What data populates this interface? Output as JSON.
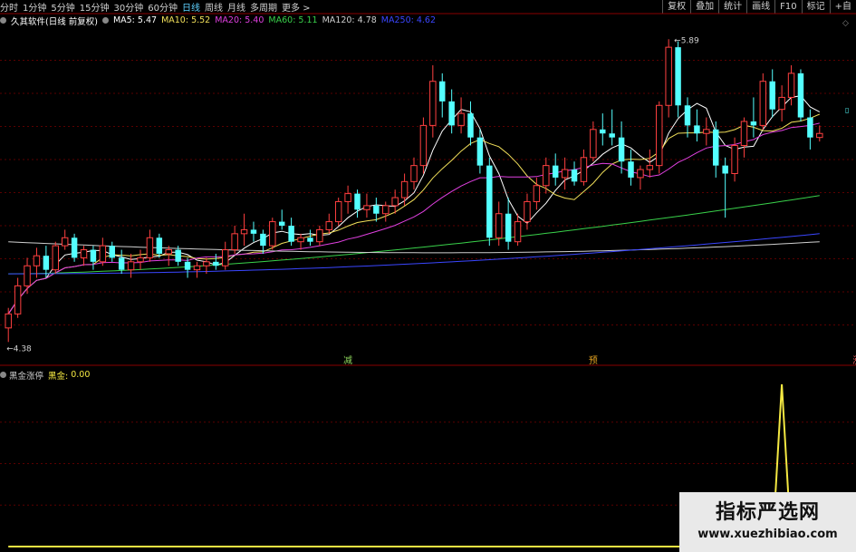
{
  "toolbar": {
    "periods": [
      "分时",
      "1分钟",
      "5分钟",
      "15分钟",
      "30分钟",
      "60分钟",
      "日线",
      "周线",
      "月线",
      "多周期",
      "更多 >"
    ],
    "active_period": "日线",
    "buttons": [
      "复权",
      "叠加",
      "统计",
      "画线",
      "F10",
      "标记",
      "+自"
    ]
  },
  "legend": {
    "title": "久其软件(日线 前复权)",
    "items": [
      {
        "label": "MA5: 5.47",
        "color": "#ffffff"
      },
      {
        "label": "MA10: 5.52",
        "color": "#f2e05a"
      },
      {
        "label": "MA20: 5.40",
        "color": "#e040e0"
      },
      {
        "label": "MA60: 5.11",
        "color": "#39d14a"
      },
      {
        "label": "MA120: 4.78",
        "color": "#cfcfcf"
      },
      {
        "label": "MA250: 4.62",
        "color": "#3a46ff"
      }
    ]
  },
  "price_labels": {
    "high": "5.89",
    "low": "4.38"
  },
  "signals": [
    {
      "label": "减",
      "color": "#8bd35a"
    },
    {
      "label": "预",
      "color": "#e0a020"
    },
    {
      "label": "涨",
      "color": "#ff6060"
    }
  ],
  "indicator": {
    "name": "黑金涨停",
    "value_label": "黑金:",
    "value": "0.00",
    "color": "#f4e842"
  },
  "watermark": {
    "title": "指标严选网",
    "url": "www.xuezhibiao.com"
  },
  "chart_data": {
    "type": "candlestick",
    "up_color": "#ff4040",
    "down_color": "#54ffff",
    "candles": [
      [
        4.45,
        4.55,
        4.38,
        4.52
      ],
      [
        4.52,
        4.7,
        4.5,
        4.66
      ],
      [
        4.66,
        4.8,
        4.62,
        4.76
      ],
      [
        4.76,
        4.85,
        4.7,
        4.81
      ],
      [
        4.81,
        4.86,
        4.7,
        4.74
      ],
      [
        4.74,
        4.88,
        4.72,
        4.86
      ],
      [
        4.86,
        4.94,
        4.84,
        4.9
      ],
      [
        4.9,
        4.92,
        4.78,
        4.8
      ],
      [
        4.8,
        4.86,
        4.76,
        4.84
      ],
      [
        4.84,
        4.86,
        4.74,
        4.78
      ],
      [
        4.78,
        4.9,
        4.76,
        4.86
      ],
      [
        4.86,
        4.88,
        4.78,
        4.8
      ],
      [
        4.8,
        4.84,
        4.72,
        4.74
      ],
      [
        4.74,
        4.82,
        4.7,
        4.78
      ],
      [
        4.78,
        4.84,
        4.74,
        4.8
      ],
      [
        4.8,
        4.94,
        4.78,
        4.9
      ],
      [
        4.9,
        4.92,
        4.8,
        4.82
      ],
      [
        4.82,
        4.86,
        4.76,
        4.84
      ],
      [
        4.84,
        4.86,
        4.76,
        4.78
      ],
      [
        4.78,
        4.8,
        4.7,
        4.74
      ],
      [
        4.74,
        4.78,
        4.7,
        4.76
      ],
      [
        4.76,
        4.8,
        4.72,
        4.78
      ],
      [
        4.78,
        4.82,
        4.74,
        4.76
      ],
      [
        4.76,
        4.88,
        4.74,
        4.84
      ],
      [
        4.84,
        4.96,
        4.82,
        4.92
      ],
      [
        4.92,
        5.02,
        4.86,
        4.94
      ],
      [
        4.94,
        4.98,
        4.88,
        4.92
      ],
      [
        4.92,
        4.94,
        4.82,
        4.86
      ],
      [
        4.86,
        5.0,
        4.84,
        4.98
      ],
      [
        4.98,
        5.04,
        4.94,
        4.96
      ],
      [
        4.96,
        5.0,
        4.86,
        4.88
      ],
      [
        4.88,
        4.92,
        4.84,
        4.9
      ],
      [
        4.9,
        4.94,
        4.86,
        4.88
      ],
      [
        4.88,
        4.96,
        4.86,
        4.94
      ],
      [
        4.94,
        5.02,
        4.92,
        4.98
      ],
      [
        4.98,
        5.1,
        4.96,
        5.08
      ],
      [
        5.08,
        5.16,
        5.02,
        5.12
      ],
      [
        5.12,
        5.14,
        5.0,
        5.04
      ],
      [
        5.04,
        5.12,
        5.0,
        5.06
      ],
      [
        5.06,
        5.1,
        4.98,
        5.02
      ],
      [
        5.02,
        5.08,
        4.98,
        5.06
      ],
      [
        5.06,
        5.14,
        5.02,
        5.1
      ],
      [
        5.1,
        5.22,
        5.06,
        5.18
      ],
      [
        5.18,
        5.3,
        5.14,
        5.26
      ],
      [
        5.26,
        5.5,
        5.22,
        5.46
      ],
      [
        5.46,
        5.76,
        5.4,
        5.68
      ],
      [
        5.68,
        5.72,
        5.5,
        5.58
      ],
      [
        5.58,
        5.64,
        5.42,
        5.46
      ],
      [
        5.46,
        5.6,
        5.42,
        5.52
      ],
      [
        5.52,
        5.58,
        5.36,
        5.4
      ],
      [
        5.4,
        5.44,
        5.22,
        5.26
      ],
      [
        5.26,
        5.3,
        4.86,
        4.9
      ],
      [
        4.9,
        5.08,
        4.86,
        5.02
      ],
      [
        5.02,
        5.1,
        4.84,
        4.88
      ],
      [
        4.88,
        5.02,
        4.86,
        4.98
      ],
      [
        4.98,
        5.12,
        4.94,
        5.08
      ],
      [
        5.08,
        5.2,
        5.04,
        5.16
      ],
      [
        5.16,
        5.3,
        5.12,
        5.26
      ],
      [
        5.26,
        5.32,
        5.16,
        5.2
      ],
      [
        5.2,
        5.3,
        5.14,
        5.24
      ],
      [
        5.24,
        5.28,
        5.16,
        5.18
      ],
      [
        5.18,
        5.34,
        5.16,
        5.3
      ],
      [
        5.3,
        5.48,
        5.28,
        5.44
      ],
      [
        5.44,
        5.52,
        5.36,
        5.42
      ],
      [
        5.42,
        5.54,
        5.36,
        5.4
      ],
      [
        5.4,
        5.48,
        5.22,
        5.28
      ],
      [
        5.28,
        5.34,
        5.16,
        5.2
      ],
      [
        5.2,
        5.26,
        5.14,
        5.24
      ],
      [
        5.24,
        5.34,
        5.2,
        5.26
      ],
      [
        5.26,
        5.58,
        5.22,
        5.56
      ],
      [
        5.56,
        5.89,
        5.5,
        5.85
      ],
      [
        5.85,
        5.88,
        5.5,
        5.56
      ],
      [
        5.56,
        5.6,
        5.4,
        5.46
      ],
      [
        5.46,
        5.54,
        5.38,
        5.42
      ],
      [
        5.42,
        5.5,
        5.36,
        5.44
      ],
      [
        5.44,
        5.48,
        5.2,
        5.26
      ],
      [
        5.26,
        5.3,
        5.0,
        5.22
      ],
      [
        5.22,
        5.4,
        5.18,
        5.36
      ],
      [
        5.36,
        5.5,
        5.3,
        5.48
      ],
      [
        5.48,
        5.6,
        5.4,
        5.46
      ],
      [
        5.46,
        5.72,
        5.44,
        5.68
      ],
      [
        5.68,
        5.74,
        5.5,
        5.54
      ],
      [
        5.54,
        5.66,
        5.48,
        5.6
      ],
      [
        5.6,
        5.76,
        5.56,
        5.72
      ],
      [
        5.72,
        5.74,
        5.48,
        5.5
      ],
      [
        5.5,
        5.54,
        5.34,
        5.4
      ],
      [
        5.4,
        5.46,
        5.38,
        5.42
      ]
    ],
    "ma_series": [
      {
        "name": "MA5",
        "color": "#ffffff"
      },
      {
        "name": "MA10",
        "color": "#f2e05a"
      },
      {
        "name": "MA20",
        "color": "#e040e0"
      },
      {
        "name": "MA60",
        "color": "#39d14a"
      },
      {
        "name": "MA120",
        "color": "#cfcfcf"
      },
      {
        "name": "MA250",
        "color": "#3a46ff"
      }
    ],
    "ylim": [
      4.3,
      5.95
    ],
    "signal_index": [
      36,
      62,
      90
    ],
    "indicator_values_at_spike": {
      "index": 82,
      "value": 1.0
    },
    "indicator_ylim": [
      0,
      1.0
    ]
  }
}
